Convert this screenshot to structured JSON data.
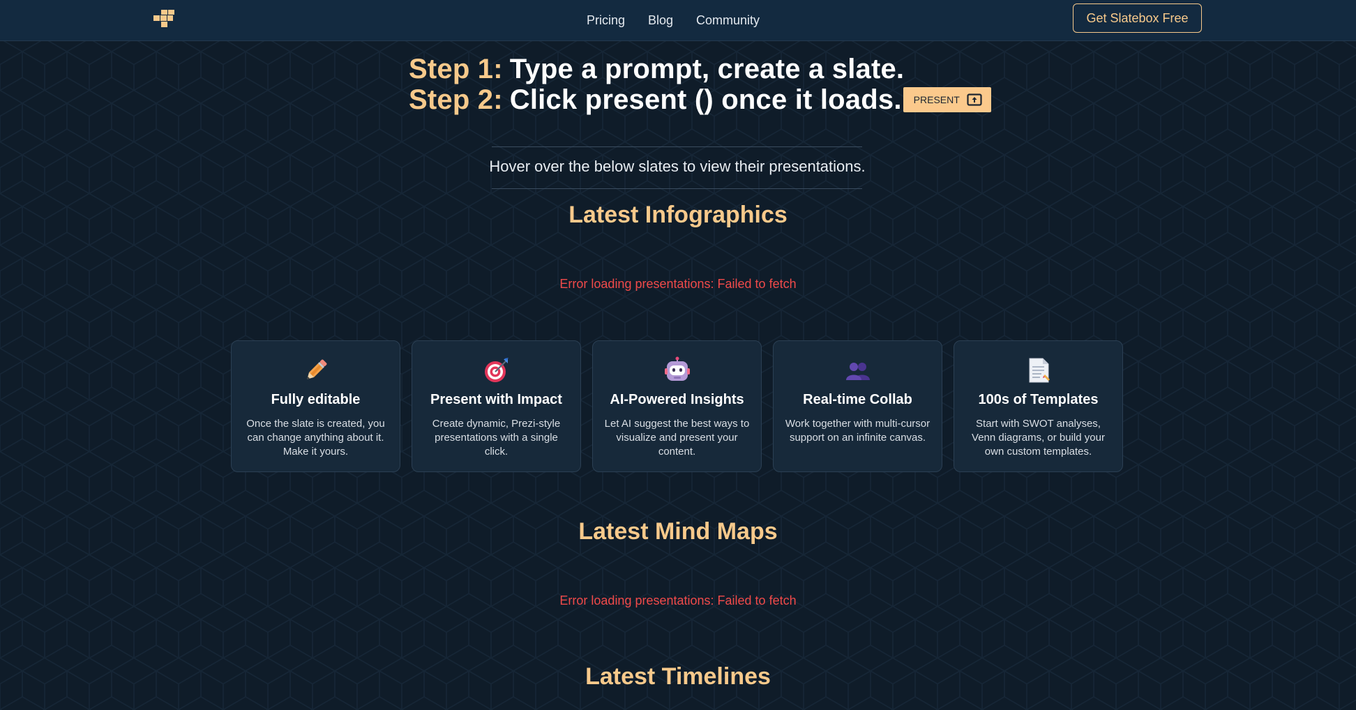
{
  "header": {
    "nav": [
      {
        "label": "Pricing"
      },
      {
        "label": "Blog"
      },
      {
        "label": "Community"
      }
    ],
    "cta_label": "Get Slatebox Free"
  },
  "hero": {
    "step1_label": "Step 1:",
    "step1_text": "Type a prompt, create a slate.",
    "step2_label": "Step 2:",
    "step2_text": "Click present () once it loads.",
    "present_button_label": "PRESENT",
    "hover_hint": "Hover over the below slates to view their presentations."
  },
  "sections": {
    "infographics": {
      "title": "Latest Infographics",
      "error": "Error loading presentations: Failed to fetch"
    },
    "mind_maps": {
      "title": "Latest Mind Maps",
      "error": "Error loading presentations: Failed to fetch"
    },
    "timelines": {
      "title": "Latest Timelines"
    }
  },
  "features": [
    {
      "icon": "pencil-icon",
      "title": "Fully editable",
      "description": "Once the slate is created, you can change anything about it. Make it yours."
    },
    {
      "icon": "target-icon",
      "title": "Present with Impact",
      "description": "Create dynamic, Prezi-style presentations with a single click."
    },
    {
      "icon": "robot-icon",
      "title": "AI-Powered Insights",
      "description": "Let AI suggest the best ways to visualize and present your content."
    },
    {
      "icon": "people-icon",
      "title": "Real-time Collab",
      "description": "Work together with multi-cursor support on an infinite canvas."
    },
    {
      "icon": "document-icon",
      "title": "100s of Templates",
      "description": "Start with SWOT analyses, Venn diagrams, or build your own custom templates."
    }
  ],
  "colors": {
    "background": "#0f1c29",
    "header": "#132a40",
    "accent": "#f7c98b",
    "error": "#f04a4a",
    "card": "#17293a"
  }
}
